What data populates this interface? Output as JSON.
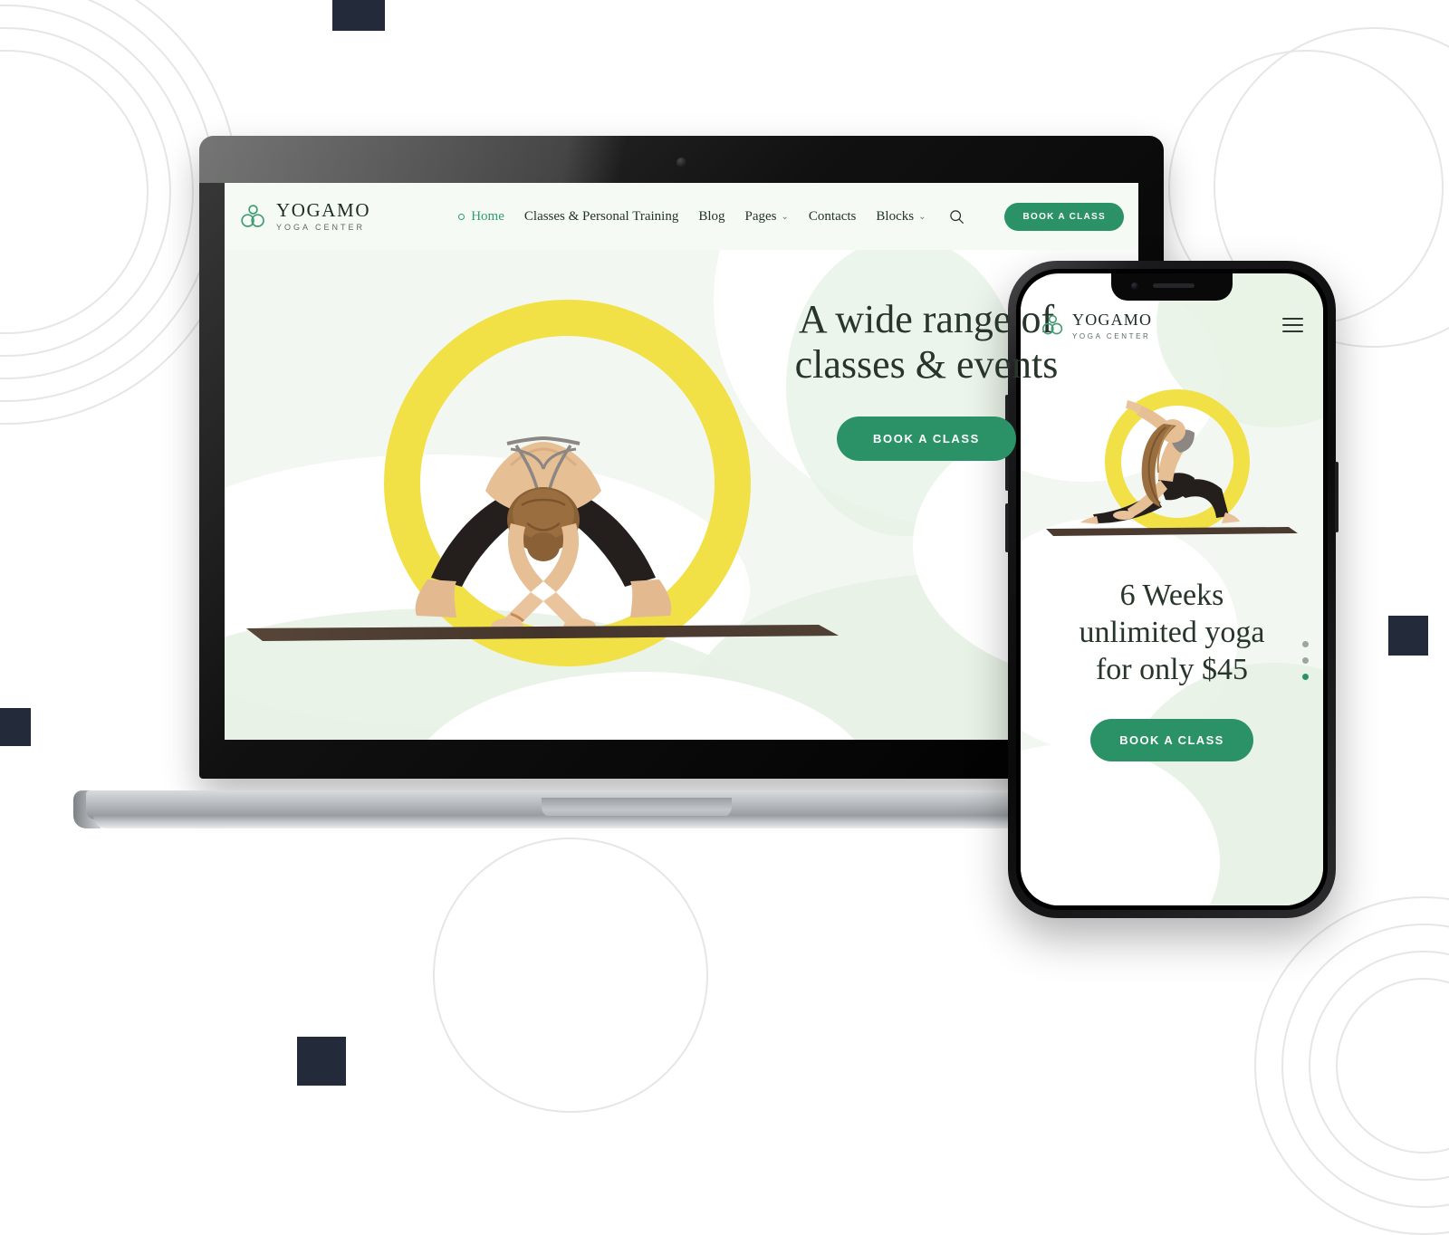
{
  "page": {
    "title": "Yogamo Yoga Center — responsive website mockup",
    "background_color": "#ffffff"
  },
  "colors": {
    "brand_green": "#2a9266",
    "accent_green": "#2e9e6b",
    "accent_yellow": "#f2e047",
    "screen_bg": "#f2f8f1",
    "dark_text": "#27352b",
    "decor_square": "#232b3a",
    "decor_ring": "#e6e6e6",
    "mat_brown": "#4a3a30"
  },
  "desktop": {
    "device": "laptop",
    "brand": {
      "logo_icon": "three-circles-logo-icon",
      "name": "YOGAMO",
      "tagline": "YOGA CENTER"
    },
    "nav": {
      "items": [
        {
          "label": "Home",
          "active": true,
          "has_caret": false,
          "has_dot": true
        },
        {
          "label": "Classes & Personal Training",
          "active": false,
          "has_caret": false,
          "has_dot": false
        },
        {
          "label": "Blog",
          "active": false,
          "has_caret": false,
          "has_dot": false
        },
        {
          "label": "Pages",
          "active": false,
          "has_caret": true,
          "has_dot": false
        },
        {
          "label": "Contacts",
          "active": false,
          "has_caret": false,
          "has_dot": false
        },
        {
          "label": "Blocks",
          "active": false,
          "has_caret": true,
          "has_dot": false
        }
      ],
      "search_icon": "search-icon",
      "caret_glyph": "⌄",
      "cta_label": "BOOK A CLASS"
    },
    "hero": {
      "heading_line_1": "A wide range of",
      "heading_line_2": "classes & events",
      "cta_label": "BOOK A CLASS",
      "image_alt": "woman in wide-legged forward bend yoga pose on a dark mat inside a yellow ring"
    }
  },
  "mobile": {
    "device": "smartphone",
    "brand": {
      "logo_icon": "three-circles-logo-icon",
      "name": "YOGAMO",
      "tagline": "YOGA CENTER"
    },
    "nav": {
      "menu_icon": "hamburger-menu-icon"
    },
    "hero": {
      "heading_line_1": "6 Weeks",
      "heading_line_2": "unlimited yoga",
      "heading_line_3": "for only $45",
      "cta_label": "BOOK A CLASS",
      "image_alt": "woman in low lunge backbend yoga pose on a dark mat inside a yellow ring"
    },
    "slider": {
      "dots": [
        {
          "active": false
        },
        {
          "active": false
        },
        {
          "active": true
        }
      ]
    }
  },
  "decor": {
    "rings_left": {
      "count": 5,
      "note": "concentric outline circles, upper-left"
    },
    "rings_bottom_right": {
      "count": 4,
      "note": "concentric outline circles, lower-right"
    },
    "ring_bottom_center": {
      "count": 1,
      "note": "single outline circle, lower-center"
    },
    "ring_top_right": {
      "count": 2,
      "note": "concentric outline circles, upper-right"
    },
    "squares": [
      {
        "name": "square-top-left",
        "size": 58
      },
      {
        "name": "square-left-mid",
        "size": 42
      },
      {
        "name": "square-right-mid",
        "size": 44
      },
      {
        "name": "square-bottom-center",
        "size": 54
      }
    ]
  }
}
